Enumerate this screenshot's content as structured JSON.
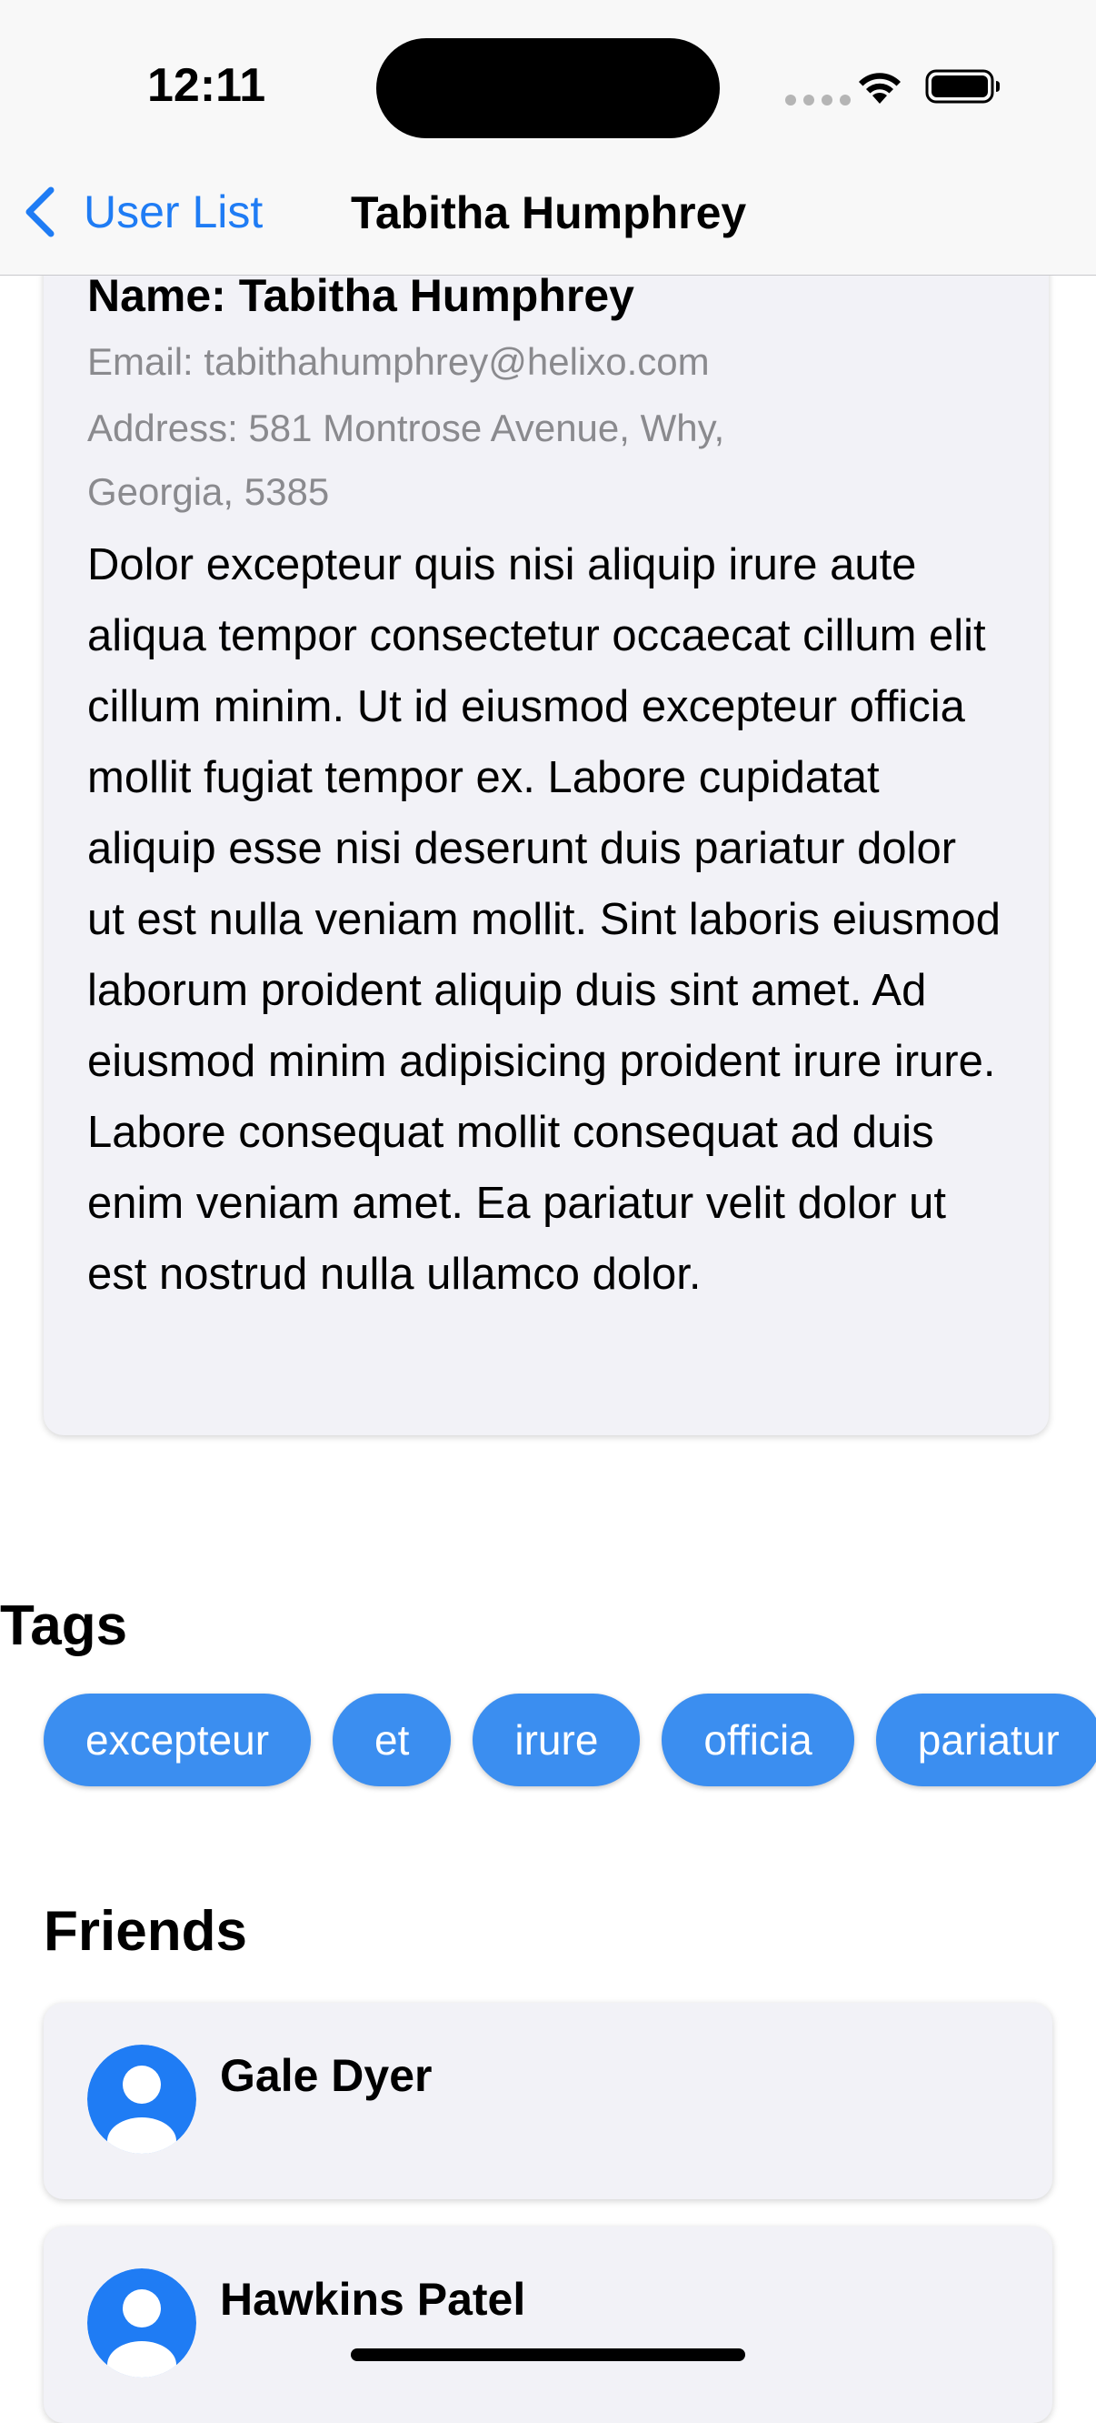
{
  "status_bar": {
    "time": "12:11"
  },
  "nav": {
    "back_label": "User List",
    "title": "Tabitha Humphrey",
    "accent_color": "#1f7cf4"
  },
  "profile": {
    "name": "Name: Tabitha Humphrey",
    "email": "Email: tabithahumphrey@helixo.com",
    "address": "Address: 581 Montrose Avenue, Why, Georgia, 5385",
    "about": "Dolor excepteur quis nisi aliquip irure aute aliqua tempor consectetur occaecat cillum elit cillum minim. Ut id eiusmod excepteur officia mollit fugiat tempor ex. Labore cupidatat aliquip esse nisi deserunt duis pariatur dolor ut est nulla veniam mollit. Sint laboris eiusmod laborum proident aliquip duis sint amet. Ad eiusmod minim adipisicing proident irure irure. Labore consequat mollit consequat ad duis enim veniam amet. Ea pariatur velit dolor ut est nostrud nulla ullamco dolor."
  },
  "tags": {
    "title": "Tags",
    "tag_color": "#3b8ef0",
    "items": [
      "excepteur",
      "et",
      "irure",
      "officia",
      "pariatur"
    ]
  },
  "friends": {
    "title": "Friends",
    "avatar_icon": "person-circle-icon",
    "items": [
      {
        "name": "Gale Dyer"
      },
      {
        "name": "Hawkins Patel"
      }
    ]
  }
}
